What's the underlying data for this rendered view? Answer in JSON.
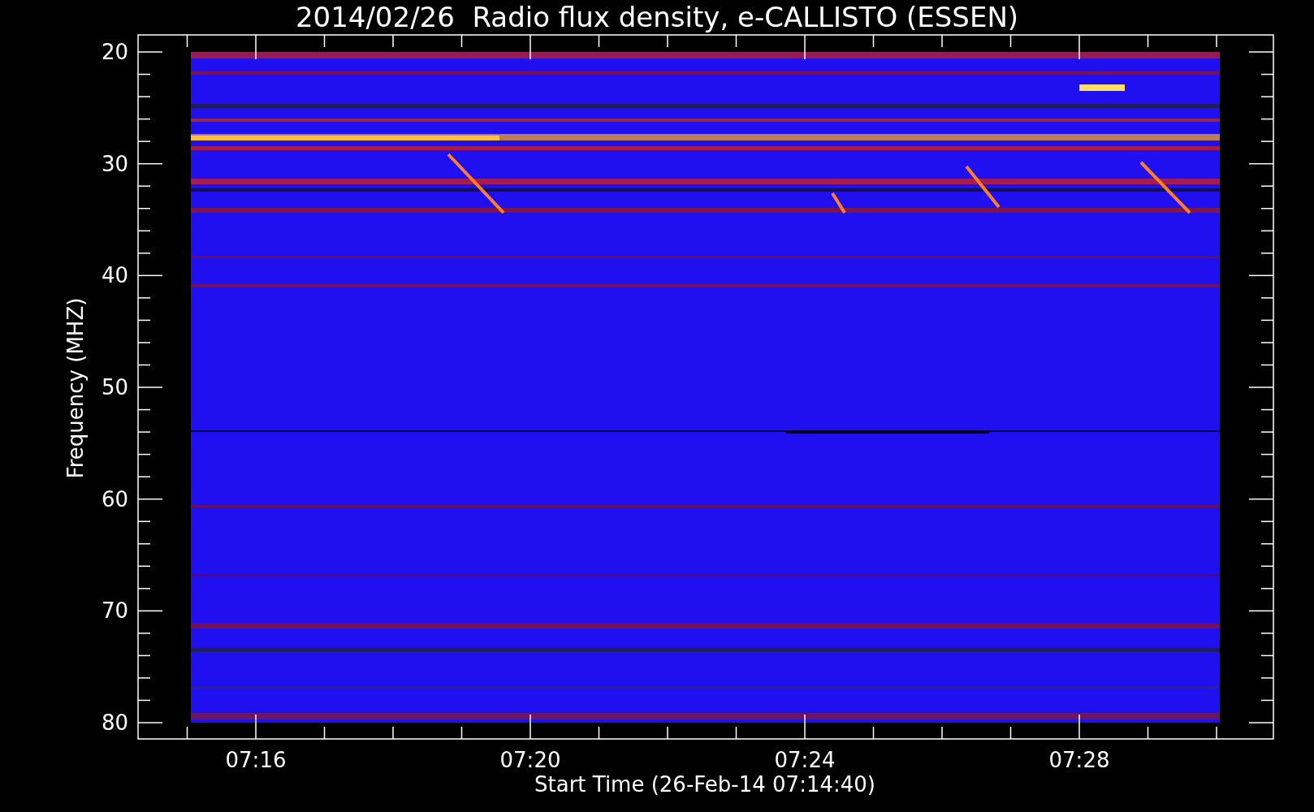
{
  "plot": {
    "title": "2014/02/26  Radio flux density, e-CALLISTO (ESSEN)",
    "ylabel": "Frequency (MHZ)",
    "xlabel": "Start Time (26-Feb-14 07:14:40)",
    "yticks": [
      "20",
      "30",
      "40",
      "50",
      "60",
      "70",
      "80"
    ],
    "xticks": [
      "07:16",
      "07:20",
      "07:24",
      "07:28"
    ]
  }
}
